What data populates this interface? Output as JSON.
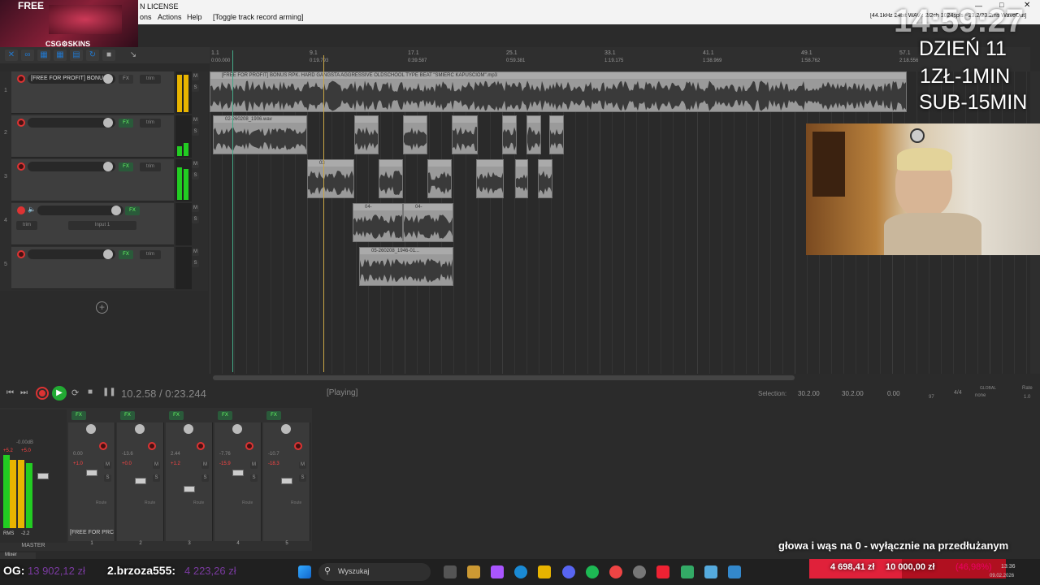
{
  "menu": {
    "title_suffix": "N LICENSE",
    "items": [
      "ons",
      "Actions",
      "Help"
    ],
    "toggle_hint": "[Toggle track record arming]",
    "status_right": "[44.1kHz 24bit WAV : 2/2ch 1024spls ~23.2/23.2ms WaveOut]"
  },
  "logo": {
    "top": "FREE",
    "brand": "CSG⚙SKINS"
  },
  "overlay": {
    "clock": "14:59:27",
    "day": "DZIEŃ 11",
    "rate": "1ZŁ-1MIN",
    "sub": "SUB-15MIN",
    "ticker": "głowa i wąs na 0 - wyłącznie na przedłużanym",
    "og_label": "OG:",
    "og_value": "13 902,12 zł",
    "donor": "2.brzoza555:",
    "donor_value": "4 223,26 zł",
    "goal_current": "4 698,41 zł",
    "goal_target": "10 000,00 zł",
    "goal_pct": "(46,98%)"
  },
  "ruler": {
    "marks": [
      "1.1",
      "9.1",
      "17.1",
      "25.1",
      "33.1",
      "41.1",
      "49.1",
      "57.1"
    ],
    "times": [
      "0:00.000",
      "0:19.793",
      "0:39.587",
      "0:59.381",
      "1:19.175",
      "1:38.969",
      "1:58.762",
      "2:18.556"
    ]
  },
  "tracks": [
    {
      "num": "1",
      "name": "[FREE FOR PROFIT] BONU",
      "fx": "FX",
      "trim": "trim"
    },
    {
      "num": "2",
      "name": "",
      "fx": "FX",
      "trim": "trim"
    },
    {
      "num": "3",
      "name": "",
      "fx": "FX",
      "trim": "trim"
    },
    {
      "num": "4",
      "name": "",
      "fx": "FX",
      "trim": "trim",
      "input": "Input 1"
    },
    {
      "num": "5",
      "name": "",
      "fx": "FX",
      "trim": "trim"
    }
  ],
  "items": {
    "beat": "[FREE FOR PROFIT] BONUS RPK. HARD GANGSTA AGGRESSIVE OLDSCHOOL TYPE BEAT \"ŚMIERĆ KAPUŚCIOM\".mp3",
    "t2": "02-260208_1906.wav",
    "t3": "03",
    "t4a": "04-",
    "t4b": "04-",
    "t5": "05-260208_1946-01..."
  },
  "transport": {
    "position": "10.2.58 / 0:23.244",
    "state": "[Playing]",
    "selection_label": "Selection:",
    "sel_start": "30.2.00",
    "sel_end": "30.2.00",
    "sel_len": "0.00",
    "bpm": "97",
    "sig": "4/4",
    "rate_label": "Rate",
    "rate": "1.0",
    "global_label": "GLOBAL",
    "global_value": "none"
  },
  "mixer": {
    "master_label": "MASTER",
    "master_db": "-0.00dB",
    "master_peak": "+5.2",
    "master_peak2": "+5.0",
    "rms_label": "RMS",
    "rms_value": "-2.2",
    "strip1_name": "[FREE FOR PRC",
    "strips": [
      {
        "num": "1",
        "db": "0.00",
        "peak": "+1.0"
      },
      {
        "num": "2",
        "db": "-13.6",
        "peak": "+0.0"
      },
      {
        "num": "3",
        "db": "2.44",
        "peak": "+1.2"
      },
      {
        "num": "4",
        "db": "-7.76",
        "peak": "-15.9"
      },
      {
        "num": "5",
        "db": "-10.7",
        "peak": "-18.3"
      }
    ],
    "mixer_tab": "Mixer",
    "route": "Route"
  },
  "taskbar": {
    "search": "Wyszukaj",
    "time": "13:36",
    "date": "09.02.2026"
  }
}
